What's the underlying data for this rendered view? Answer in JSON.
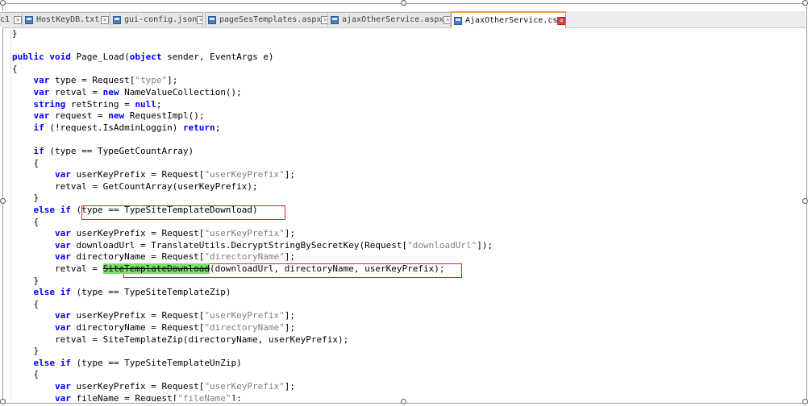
{
  "tabs": [
    {
      "label": "c1",
      "active": false
    },
    {
      "label": "HostKeyDB.txt",
      "active": false
    },
    {
      "label": "gui-config.json",
      "active": false
    },
    {
      "label": "pageSesTemplates.aspx",
      "active": false
    },
    {
      "label": "ajaxOtherService.aspx",
      "active": false
    },
    {
      "label": "AjaxOtherService.cs",
      "active": true
    }
  ],
  "code": [
    [
      [
        "p",
        "}"
      ]
    ],
    [
      [
        "p",
        ""
      ]
    ],
    [
      [
        "k",
        "public"
      ],
      [
        "p",
        " "
      ],
      [
        "k",
        "void"
      ],
      [
        "p",
        " Page_Load("
      ],
      [
        "k",
        "object"
      ],
      [
        "p",
        " sender, EventArgs e)"
      ]
    ],
    [
      [
        "p",
        "{"
      ]
    ],
    [
      [
        "p",
        "    "
      ],
      [
        "k",
        "var"
      ],
      [
        "p",
        " type = Request["
      ],
      [
        "s",
        "\"type\""
      ],
      [
        "p",
        "];"
      ]
    ],
    [
      [
        "p",
        "    "
      ],
      [
        "k",
        "var"
      ],
      [
        "p",
        " retval = "
      ],
      [
        "k",
        "new"
      ],
      [
        "p",
        " NameValueCollection();"
      ]
    ],
    [
      [
        "p",
        "    "
      ],
      [
        "k",
        "string"
      ],
      [
        "p",
        " retString = "
      ],
      [
        "k",
        "null"
      ],
      [
        "p",
        ";"
      ]
    ],
    [
      [
        "p",
        "    "
      ],
      [
        "k",
        "var"
      ],
      [
        "p",
        " request = "
      ],
      [
        "k",
        "new"
      ],
      [
        "p",
        " RequestImpl();"
      ]
    ],
    [
      [
        "p",
        "    "
      ],
      [
        "k",
        "if"
      ],
      [
        "p",
        " (!request.IsAdminLoggin) "
      ],
      [
        "k",
        "return"
      ],
      [
        "p",
        ";"
      ]
    ],
    [
      [
        "p",
        ""
      ]
    ],
    [
      [
        "p",
        "    "
      ],
      [
        "k",
        "if"
      ],
      [
        "p",
        " (type == TypeGetCountArray)"
      ]
    ],
    [
      [
        "p",
        "    {"
      ]
    ],
    [
      [
        "p",
        "        "
      ],
      [
        "k",
        "var"
      ],
      [
        "p",
        " userKeyPrefix = Request["
      ],
      [
        "s",
        "\"userKeyPrefix\""
      ],
      [
        "p",
        "];"
      ]
    ],
    [
      [
        "p",
        "        retval = GetCountArray(userKeyPrefix);"
      ]
    ],
    [
      [
        "p",
        "    }"
      ]
    ],
    [
      [
        "p",
        "    "
      ],
      [
        "k",
        "else if"
      ],
      [
        "p",
        " (type == TypeSiteTemplateDownload)"
      ]
    ],
    [
      [
        "p",
        "    {"
      ]
    ],
    [
      [
        "p",
        "        "
      ],
      [
        "k",
        "var"
      ],
      [
        "p",
        " userKeyPrefix = Request["
      ],
      [
        "s",
        "\"userKeyPrefix\""
      ],
      [
        "p",
        "];"
      ]
    ],
    [
      [
        "p",
        "        "
      ],
      [
        "k",
        "var"
      ],
      [
        "p",
        " downloadUrl = TranslateUtils.DecryptStringBySecretKey(Request["
      ],
      [
        "s",
        "\"downloadUrl\""
      ],
      [
        "p",
        "]);"
      ]
    ],
    [
      [
        "p",
        "        "
      ],
      [
        "k",
        "var"
      ],
      [
        "p",
        " directoryName = Request["
      ],
      [
        "s",
        "\"directoryName\""
      ],
      [
        "p",
        "];"
      ]
    ],
    [
      [
        "p",
        "        retval = "
      ],
      [
        "h",
        "SiteTemplateDownload"
      ],
      [
        "p",
        "(downloadUrl, directoryName, userKeyPrefix);"
      ]
    ],
    [
      [
        "p",
        "    }"
      ]
    ],
    [
      [
        "p",
        "    "
      ],
      [
        "k",
        "else if"
      ],
      [
        "p",
        " (type == TypeSiteTemplateZip)"
      ]
    ],
    [
      [
        "p",
        "    {"
      ]
    ],
    [
      [
        "p",
        "        "
      ],
      [
        "k",
        "var"
      ],
      [
        "p",
        " userKeyPrefix = Request["
      ],
      [
        "s",
        "\"userKeyPrefix\""
      ],
      [
        "p",
        "];"
      ]
    ],
    [
      [
        "p",
        "        "
      ],
      [
        "k",
        "var"
      ],
      [
        "p",
        " directoryName = Request["
      ],
      [
        "s",
        "\"directoryName\""
      ],
      [
        "p",
        "];"
      ]
    ],
    [
      [
        "p",
        "        retval = SiteTemplateZip(directoryName, userKeyPrefix);"
      ]
    ],
    [
      [
        "p",
        "    }"
      ]
    ],
    [
      [
        "p",
        "    "
      ],
      [
        "k",
        "else if"
      ],
      [
        "p",
        " (type == TypeSiteTemplateUnZip)"
      ]
    ],
    [
      [
        "p",
        "    {"
      ]
    ],
    [
      [
        "p",
        "        "
      ],
      [
        "k",
        "var"
      ],
      [
        "p",
        " userKeyPrefix = Request["
      ],
      [
        "s",
        "\"userKeyPrefix\""
      ],
      [
        "p",
        "];"
      ]
    ],
    [
      [
        "p",
        "        "
      ],
      [
        "k",
        "var"
      ],
      [
        "p",
        " fileName = Request["
      ],
      [
        "s",
        "\"fileName\""
      ],
      [
        "p",
        "];"
      ]
    ]
  ],
  "colors": {
    "keyword": "#0000ff",
    "string": "#808080",
    "annotation": "#e02020",
    "highlight": "#7dde6e"
  }
}
